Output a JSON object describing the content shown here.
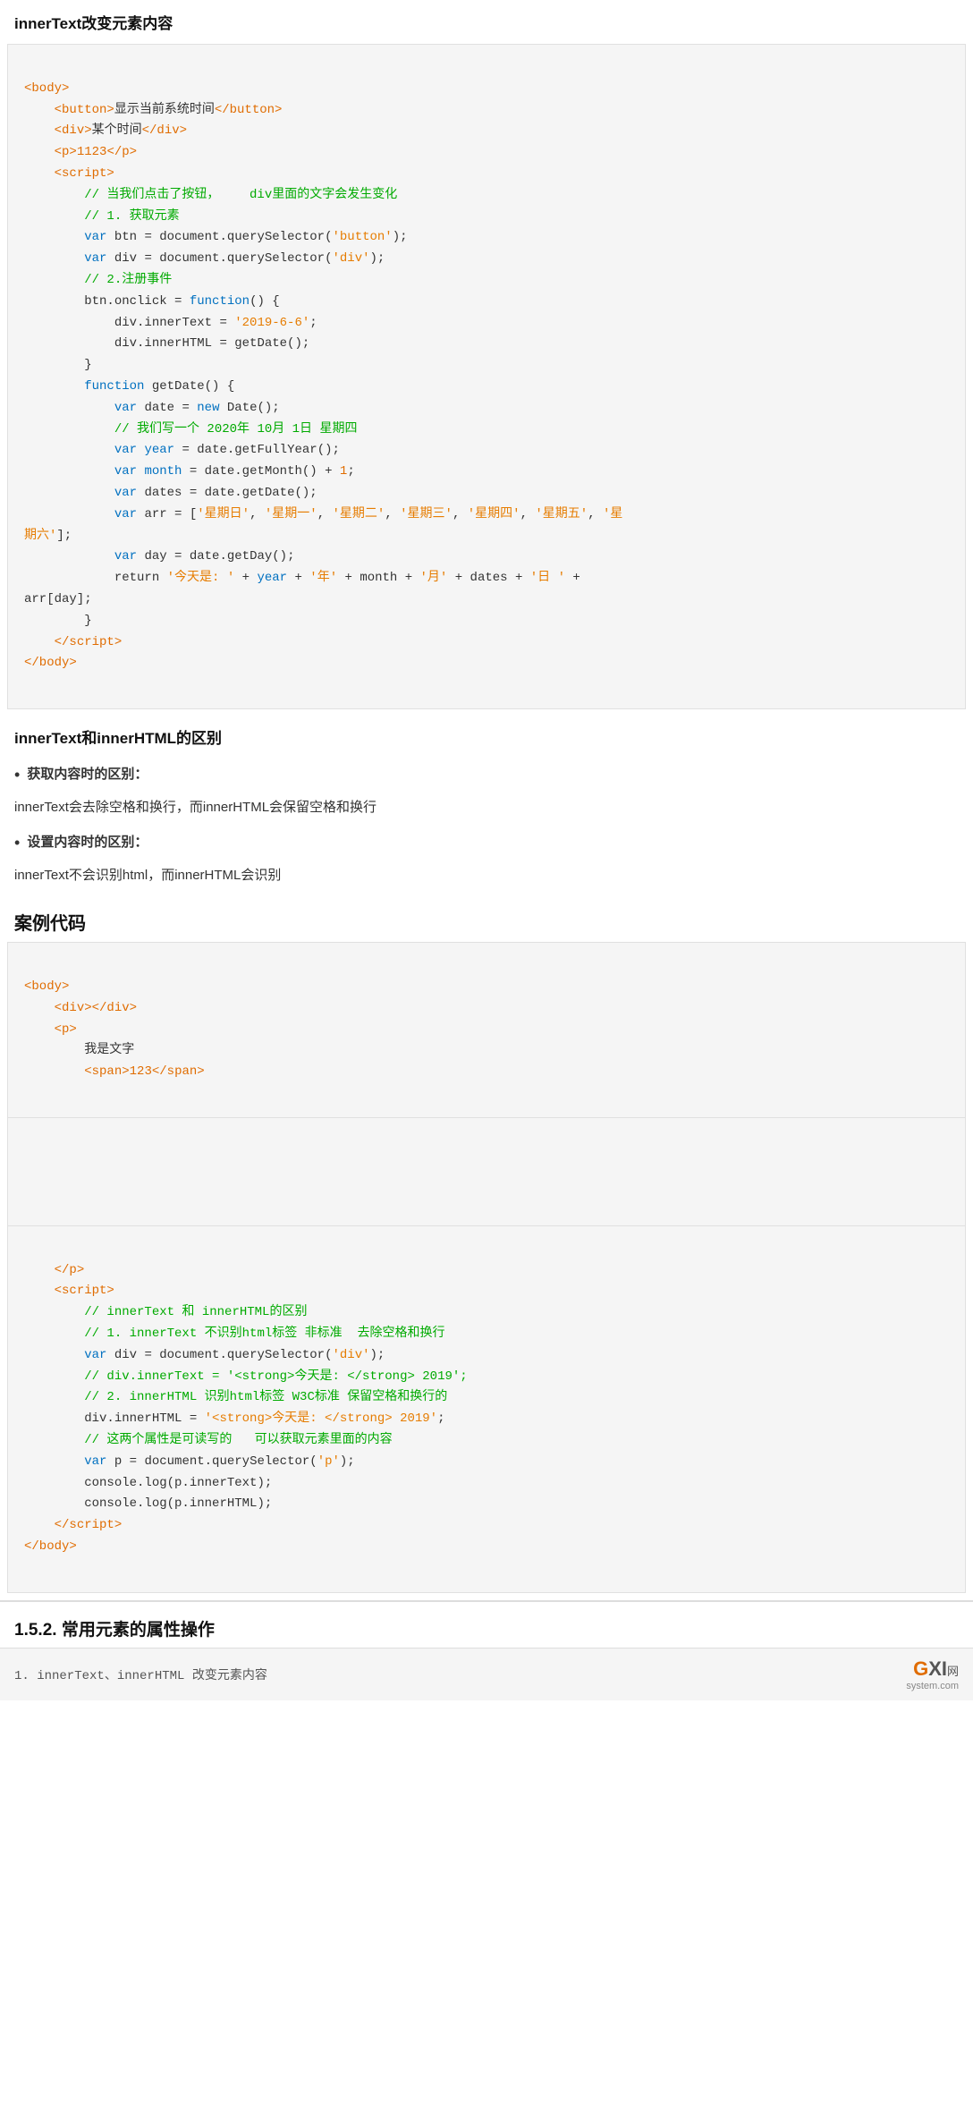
{
  "sections": {
    "title1": "innerText改变元素内容",
    "title2": "innerText和innerHTML的区别",
    "title3": "案例代码",
    "title4": "1.5.2. 常用元素的属性操作"
  },
  "codeBlock1": {
    "lines": [
      {
        "type": "tag",
        "content": "<body>"
      },
      {
        "type": "mixed",
        "parts": [
          {
            "t": "indent2"
          },
          {
            "t": "tag",
            "v": "<button>"
          },
          {
            "t": "text",
            "v": "显示当前系统时间"
          },
          {
            "t": "closetag",
            "v": "</button>"
          }
        ]
      },
      {
        "type": "mixed",
        "parts": [
          {
            "t": "indent2"
          },
          {
            "t": "tag",
            "v": "<div>"
          },
          {
            "t": "text",
            "v": "某个时间"
          },
          {
            "t": "closetag",
            "v": "</div>"
          }
        ]
      },
      {
        "type": "mixed",
        "parts": [
          {
            "t": "indent2"
          },
          {
            "t": "tag",
            "v": "<p>"
          },
          {
            "t": "number",
            "v": "1123"
          },
          {
            "t": "closetag",
            "v": "</p>"
          }
        ]
      },
      {
        "type": "mixed",
        "parts": [
          {
            "t": "indent2"
          },
          {
            "t": "tag",
            "v": "<script>"
          }
        ]
      },
      {
        "type": "comment",
        "content": "        // 当我们点击了按钮，   div里面的文字会发生变化"
      },
      {
        "type": "comment",
        "content": "        // 1. 获取元素"
      },
      {
        "type": "code",
        "content": "        var btn = document.querySelector("
      },
      {
        "type": "mixed2"
      },
      {
        "type": "code2"
      }
    ]
  },
  "bullets": {
    "item1": "获取内容时的区别：",
    "text1": "innerText会去除空格和换行，而innerHTML会保留空格和换行",
    "item2": "设置内容时的区别：",
    "text2": "innerText不会识别html，而innerHTML会识别"
  },
  "bottomBar": {
    "text": "1. innerText、innerHTML  改变元素内容",
    "logo": "GXI网",
    "domain": "system.com"
  }
}
